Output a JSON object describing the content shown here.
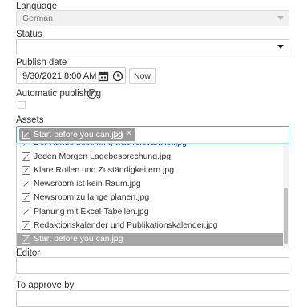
{
  "language": {
    "label": "Language",
    "value": "German"
  },
  "status": {
    "label": "Status",
    "value": ""
  },
  "publish_date": {
    "label": "Publish date",
    "value": "9/30/2021 8:00 AM",
    "now_label": "Now"
  },
  "automatic_publishing": {
    "label": "Automatic publishing",
    "help_icon": "question-circle-icon",
    "checked": false
  },
  "assets": {
    "label": "Assets",
    "selected_chip": "Start before you can.jpg",
    "remove_glyph": "×",
    "options": [
      "Der Kunde bestimmt, was relevant ist.jpg",
      "Jeden Morgen Lagebesprechung.jpg",
      "Klare Rollen und Zuständigkeitern.jpg",
      "Newsroom ist kein Raum.jpg",
      "Newsroom zu lange planen.jpg",
      "Planung mit Excel-Tabellen.jpg",
      "Redaktionskalender und Publikationskalender.jpg",
      "Start before you can.jpg"
    ],
    "selected_index": 7
  },
  "editor": {
    "label": "Editor",
    "value": ""
  },
  "to_approve_by": {
    "label": "To approve by",
    "value": ""
  },
  "colors": {
    "focus_border": "#5b9bd5",
    "chip_bg": "#9a9a9a",
    "selected_row": "#a6a6a6"
  }
}
